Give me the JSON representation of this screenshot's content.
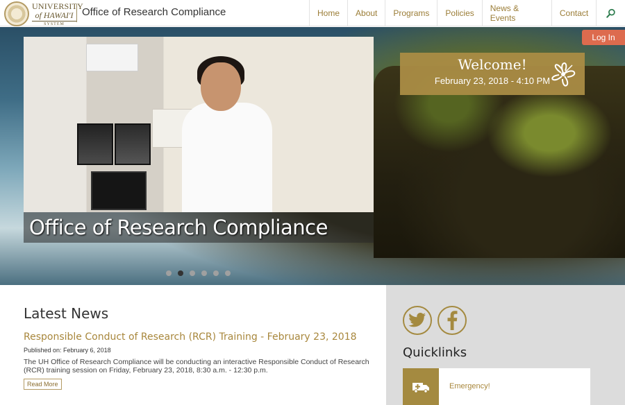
{
  "header": {
    "logo_line1": "UNIVERSITY",
    "logo_line2": "of HAWAI'I",
    "logo_line3": "SYSTEM",
    "site_title": "Office of Research Compliance",
    "nav": [
      "Home",
      "About",
      "Programs",
      "Policies",
      "News & Events",
      "Contact"
    ],
    "search_icon": "search-icon"
  },
  "login_label": "Log In",
  "hero": {
    "caption": "Office of Research Compliance",
    "slide_count": 6,
    "active_slide": 2
  },
  "welcome": {
    "title": "Welcome!",
    "datetime": "February 23, 2018 - 4:10 PM",
    "icon": "hibiscus-icon"
  },
  "news": {
    "heading": "Latest News",
    "items": [
      {
        "title": "Responsible Conduct of Research (RCR) Training - February 23, 2018",
        "published": "Published on: February 6, 2018",
        "summary": "The UH Office of Research Compliance will be conducting an interactive Responsible Conduct of Research (RCR) training session on Friday, February 23, 2018, 8:30 a.m. - 12:30 p.m.",
        "read_more": "Read More"
      }
    ]
  },
  "sidebar": {
    "social": [
      "twitter-icon",
      "facebook-icon"
    ],
    "quicklinks_heading": "Quicklinks",
    "quicklinks": [
      {
        "label": "Emergency!",
        "icon": "ambulance-icon"
      }
    ]
  },
  "colors": {
    "gold": "#a8873c",
    "login": "#dd6b4e",
    "sidebar_bg": "#dcdcdc"
  }
}
